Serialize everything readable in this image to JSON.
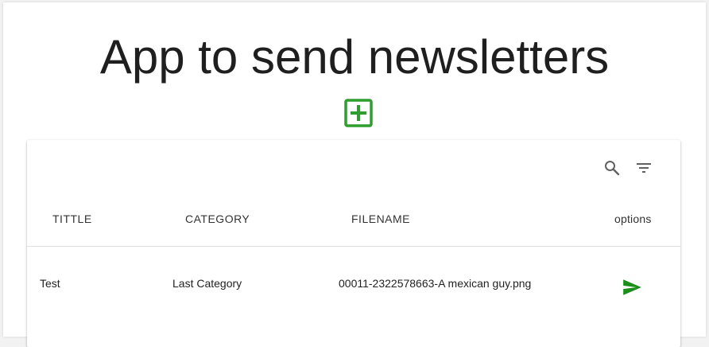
{
  "app": {
    "title": "App to send newsletters"
  },
  "toolbar": {
    "search_icon": "search-icon",
    "filter_icon": "filter-icon"
  },
  "add_button": {
    "icon": "add-box-icon",
    "color": "#2e9e2e"
  },
  "table": {
    "headers": {
      "title": "TITTLE",
      "category": "CATEGORY",
      "filename": "FILENAME",
      "options": "options"
    },
    "rows": [
      {
        "title": "Test",
        "category": "Last Category",
        "filename": "00011-2322578663-A mexican guy.png",
        "action_icon": "send-icon"
      }
    ]
  },
  "colors": {
    "accent_green": "#2e9e2e",
    "send_green": "#1a8f1a",
    "icon_gray": "#616161"
  }
}
